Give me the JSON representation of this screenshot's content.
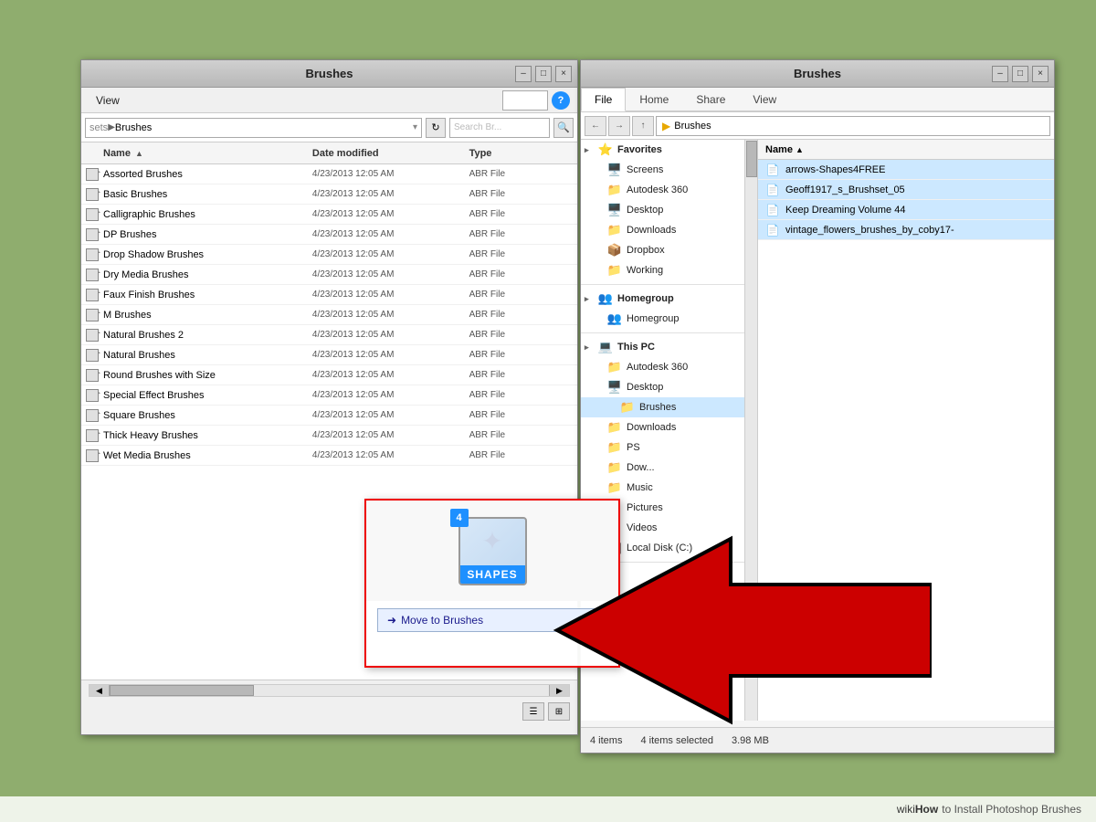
{
  "leftWindow": {
    "title": "Brushes",
    "titlebar_controls": [
      "minimize",
      "maximize",
      "close"
    ],
    "menubar": {
      "view": "View"
    },
    "addressbar": {
      "path_prefix": "sets",
      "path_current": "Brushes",
      "search_placeholder": "Search Br...",
      "refresh_icon": "↻"
    },
    "file_list_headers": {
      "name": "Name",
      "date": "Date modified",
      "type": "Type"
    },
    "files": [
      {
        "name": "Assorted Brushes",
        "date": "4/23/2013 12:05 AM",
        "type": "ABR File"
      },
      {
        "name": "Basic Brushes",
        "date": "4/23/2013 12:05 AM",
        "type": "ABR File"
      },
      {
        "name": "Calligraphic Brushes",
        "date": "4/23/2013 12:05 AM",
        "type": "ABR File"
      },
      {
        "name": "DP Brushes",
        "date": "4/23/2013 12:05 AM",
        "type": "ABR File"
      },
      {
        "name": "Drop Shadow Brushes",
        "date": "4/23/2013 12:05 AM",
        "type": "ABR File"
      },
      {
        "name": "Dry Media Brushes",
        "date": "4/23/2013 12:05 AM",
        "type": "ABR File"
      },
      {
        "name": "Faux Finish Brushes",
        "date": "4/23/2013 12:05 AM",
        "type": "ABR File"
      },
      {
        "name": "M Brushes",
        "date": "4/23/2013 12:05 AM",
        "type": "ABR File"
      },
      {
        "name": "Natural Brushes 2",
        "date": "4/23/2013 12:05 AM",
        "type": "ABR File"
      },
      {
        "name": "Natural Brushes",
        "date": "4/23/2013 12:05 AM",
        "type": "ABR File"
      },
      {
        "name": "Round Brushes with Size",
        "date": "4/23/2013 12:05 AM",
        "type": "ABR File"
      },
      {
        "name": "Special Effect Brushes",
        "date": "4/23/2013 12:05 AM",
        "type": "ABR File"
      },
      {
        "name": "Square Brushes",
        "date": "4/23/2013 12:05 AM",
        "type": "ABR File"
      },
      {
        "name": "Thick Heavy Brushes",
        "date": "4/23/2013 12:05 AM",
        "type": "ABR File"
      },
      {
        "name": "Wet Media Brushes",
        "date": "4/23/2013 12:05 AM",
        "type": "ABR File"
      }
    ],
    "drag_popup": {
      "badge_count": "4",
      "label": "SHAPES",
      "move_btn": "Move to Brushes"
    }
  },
  "rightWindow": {
    "title": "Brushes",
    "ribbon_tabs": [
      "File",
      "Home",
      "Share",
      "View"
    ],
    "active_tab": "File",
    "nav": {
      "back": "←",
      "forward": "→",
      "up": "↑",
      "path": "Brushes"
    },
    "left_tree": {
      "sections": [
        {
          "header": "Favorites",
          "items": [
            {
              "icon": "screen",
              "label": "Screens",
              "indent": 1
            },
            {
              "icon": "folder",
              "label": "Autodesk 360",
              "indent": 1
            },
            {
              "icon": "desktop",
              "label": "Desktop",
              "indent": 1
            },
            {
              "icon": "folder",
              "label": "Downloads",
              "indent": 1,
              "highlight": true
            },
            {
              "icon": "dropbox",
              "label": "Dropbox",
              "indent": 1
            },
            {
              "icon": "folder-red",
              "label": "Working",
              "indent": 1
            }
          ]
        },
        {
          "header": "Homegroup",
          "items": [
            {
              "icon": "homegroup",
              "label": "Homegroup",
              "indent": 1
            }
          ]
        },
        {
          "header": "This PC",
          "items": [
            {
              "icon": "autodesk",
              "label": "Autodesk 360",
              "indent": 1
            },
            {
              "icon": "desktop",
              "label": "Desktop",
              "indent": 1
            },
            {
              "icon": "folder",
              "label": "Brushes",
              "indent": 2,
              "selected": true
            },
            {
              "icon": "folder",
              "label": "Downloads",
              "indent": 1
            },
            {
              "icon": "folder",
              "label": "PS",
              "indent": 1
            },
            {
              "icon": "folder",
              "label": "Dow...",
              "indent": 1
            },
            {
              "icon": "folder",
              "label": "Music",
              "indent": 1
            },
            {
              "icon": "folder",
              "label": "Pictures",
              "indent": 1
            },
            {
              "icon": "folder",
              "label": "Videos",
              "indent": 1
            },
            {
              "icon": "drive",
              "label": "Local Disk (C:)",
              "indent": 1
            }
          ]
        }
      ]
    },
    "right_files": [
      {
        "name": "arrows-Shapes4FREE",
        "selected": true
      },
      {
        "name": "Geoff1917_s_Brushset_05",
        "selected": true
      },
      {
        "name": "Keep Dreaming Volume 44",
        "selected": true
      },
      {
        "name": "vintage_flowers_brushes_by_coby17-",
        "selected": true
      }
    ],
    "status": {
      "count": "4 items",
      "selected": "4 items selected",
      "size": "3.98 MB"
    }
  },
  "footer": {
    "wiki": "wiki",
    "how": "How",
    "text": "to Install Photoshop Brushes"
  },
  "icons": {
    "minimize": "–",
    "maximize": "□",
    "close": "×",
    "search": "🔍",
    "file_abr": "📄",
    "folder": "📁",
    "star": "⭐",
    "up_arrow": "▲",
    "sort_arrow": "▲"
  }
}
